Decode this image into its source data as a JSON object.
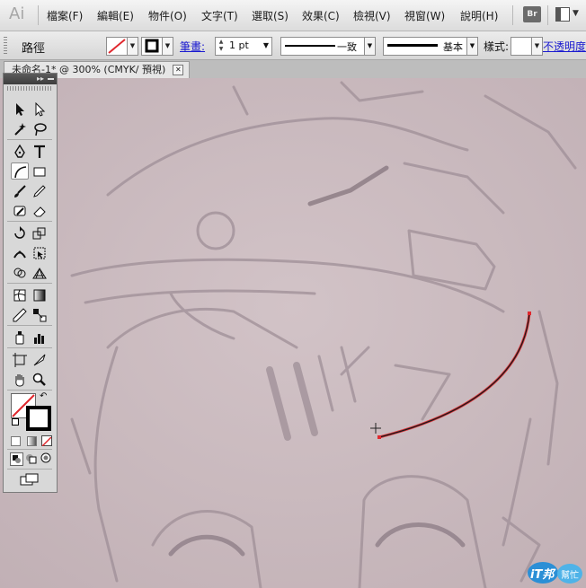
{
  "app": {
    "logo": "Ai"
  },
  "menu": {
    "items": [
      "檔案(F)",
      "編輯(E)",
      "物件(O)",
      "文字(T)",
      "選取(S)",
      "效果(C)",
      "檢視(V)",
      "視窗(W)",
      "說明(H)"
    ],
    "bridge_label": "Br"
  },
  "control": {
    "selection_type": "路徑",
    "stroke_link": "筆畫",
    "stroke_weight": "1 pt",
    "variable_width_label": "一致",
    "brush_label": "基本",
    "style_label": "樣式:",
    "opacity_link": "不透明度"
  },
  "document": {
    "tab_title": "未命名-1* @ 300% (CMYK/ 預視)",
    "close_glyph": "✕"
  },
  "colors": {
    "canvas_bg": "#c9b9bd",
    "sketch": "#9d8d92",
    "path_stroke": "#1a1a1a",
    "selection_red": "#e0282e",
    "link_blue": "#1a1ad0"
  },
  "tools": [
    "selection-tool",
    "direct-selection-tool",
    "magic-wand-tool",
    "lasso-tool",
    "pen-tool",
    "type-tool",
    "arc-tool",
    "rectangle-tool",
    "paintbrush-tool",
    "pencil-tool",
    "blob-brush-tool",
    "eraser-tool",
    "rotate-tool",
    "scale-tool",
    "width-tool",
    "free-transform-tool",
    "shape-builder-tool",
    "perspective-grid-tool",
    "mesh-tool",
    "gradient-tool",
    "eyedropper-tool",
    "blend-tool",
    "symbol-sprayer-tool",
    "column-graph-tool",
    "artboard-tool",
    "slice-tool",
    "hand-tool",
    "zoom-tool"
  ],
  "watermark": {
    "text": "iT邦",
    "sub": "幫忙"
  }
}
